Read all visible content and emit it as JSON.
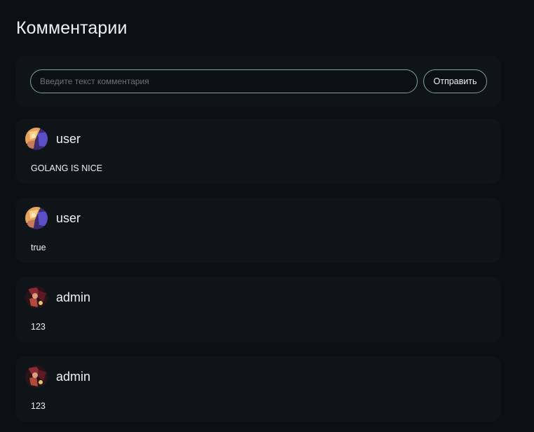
{
  "page": {
    "title": "Комментарии"
  },
  "composer": {
    "placeholder": "Введите текст комментария",
    "value": "",
    "send_label": "Отправить"
  },
  "comments": [
    {
      "username": "user",
      "text": "GOLANG IS NICE",
      "avatar": "user-avatar"
    },
    {
      "username": "user",
      "text": "true",
      "avatar": "user-avatar"
    },
    {
      "username": "admin",
      "text": "123",
      "avatar": "admin-avatar"
    },
    {
      "username": "admin",
      "text": "123",
      "avatar": "admin-avatar"
    }
  ],
  "colors": {
    "background": "#0c1014",
    "card": "#0f1418",
    "accent_border": "#7fa0ab",
    "text": "#eef0f2",
    "placeholder": "#6c747b"
  }
}
